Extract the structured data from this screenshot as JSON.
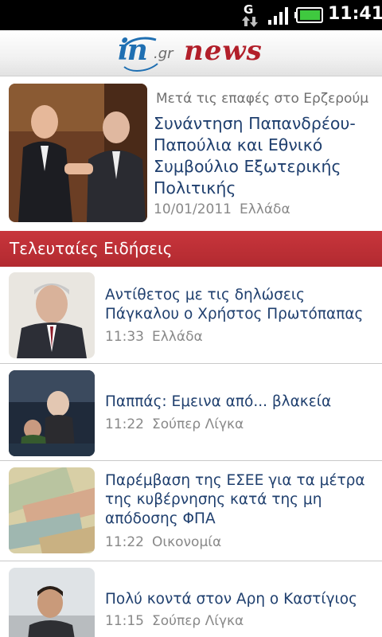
{
  "status_bar": {
    "network_type": "G",
    "time": "11:41",
    "signal_icon": "signal-bars-icon",
    "battery_icon": "battery-icon"
  },
  "header": {
    "logo_in": "in",
    "logo_domain": ".gr",
    "logo_news": "news"
  },
  "featured": {
    "kicker": "Μετά τις επαφές στο Ερζερούμ",
    "title": "Συνάντηση Παπανδρέου-Παπούλια και Εθνικό Συμβούλιο Εξωτερικής Πολιτικής",
    "date": "10/01/2011",
    "category": "Ελλάδα"
  },
  "section": {
    "title": "Τελευταίες Ειδήσεις"
  },
  "news": [
    {
      "title": "Αντίθετος με τις δηλώσεις Πάγκαλου ο Χρήστος Πρωτόπαπας",
      "time": "11:33",
      "category": "Ελλάδα"
    },
    {
      "title": "Παππάς: Εμεινα από... βλακεία",
      "time": "11:22",
      "category": "Σούπερ Λίγκα"
    },
    {
      "title": "Παρέμβαση της ΕΣΕΕ για τα μέτρα της κυβέρνησης κατά της μη απόδοσης ΦΠΑ",
      "time": "11:22",
      "category": "Οικονομία"
    },
    {
      "title": "Πολύ κοντά στον Αρη ο Καστίγιος",
      "time": "11:15",
      "category": "Σούπερ Λίγκα"
    }
  ],
  "colors": {
    "section_bg": "#b82e35",
    "title_text": "#1f3f6e",
    "meta_text": "#888888"
  }
}
